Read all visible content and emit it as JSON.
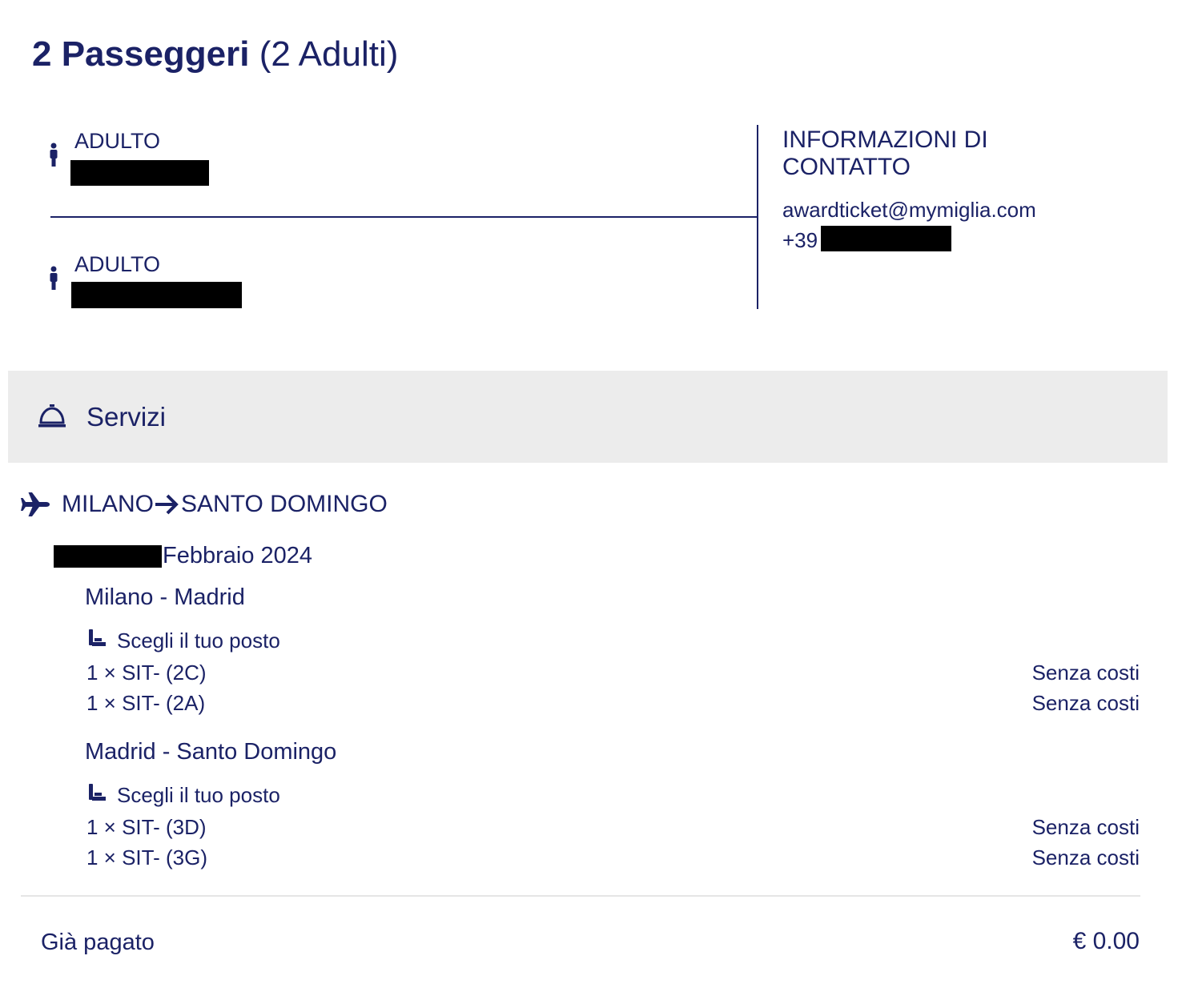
{
  "header": {
    "title_bold": "2 Passeggeri",
    "title_rest": "(2 Adulti)"
  },
  "passengers": [
    {
      "type": "ADULTO",
      "icon": "person-icon"
    },
    {
      "type": "ADULTO",
      "icon": "person-icon"
    }
  ],
  "contact": {
    "title_line1": "INFORMAZIONI DI",
    "title_line2": "CONTATTO",
    "email": "awardticket@mymiglia.com",
    "phone_prefix": "+39"
  },
  "services": {
    "label": "Servizi",
    "icon": "service-bell-icon"
  },
  "route": {
    "origin": "MILANO",
    "destination": "SANTO DOMINGO",
    "icon": "airplane-icon",
    "date_text": "Febbraio 2024"
  },
  "segments": [
    {
      "name": "Milano - Madrid",
      "seat_choice_label": "Scegli il tuo posto",
      "seats": [
        {
          "label": "1 × SIT- (2C)",
          "cost": "Senza costi"
        },
        {
          "label": "1 × SIT- (2A)",
          "cost": "Senza costi"
        }
      ]
    },
    {
      "name": "Madrid - Santo Domingo",
      "seat_choice_label": "Scegli il tuo posto",
      "seats": [
        {
          "label": "1 × SIT- (3D)",
          "cost": "Senza costi"
        },
        {
          "label": "1 × SIT- (3G)",
          "cost": "Senza costi"
        }
      ]
    }
  ],
  "summary": {
    "paid_label": "Già pagato",
    "paid_amount": "€ 0.00"
  },
  "colors": {
    "primary": "#1b2266",
    "band": "#ececec",
    "redaction": "#000000"
  }
}
